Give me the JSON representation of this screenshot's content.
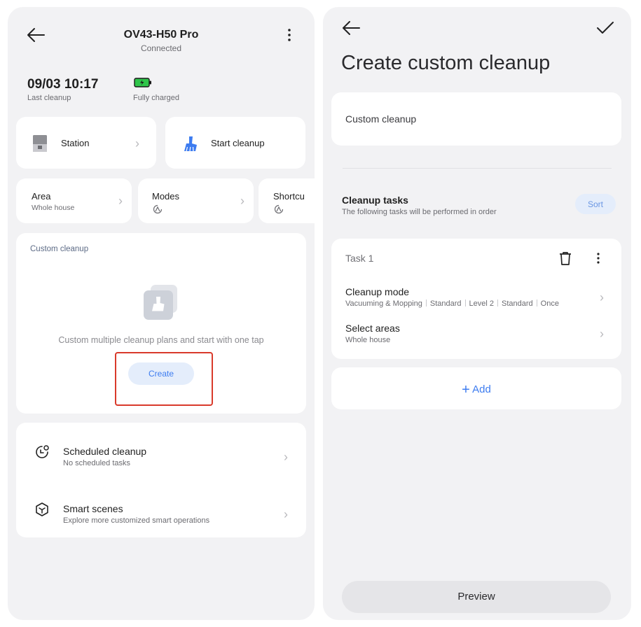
{
  "left": {
    "title": "OV43-H50 Pro",
    "status": "Connected",
    "last_cleanup_time": "09/03 10:17",
    "last_cleanup_label": "Last cleanup",
    "battery_label": "Fully charged",
    "station_label": "Station",
    "start_cleanup_label": "Start cleanup",
    "area_title": "Area",
    "area_value": "Whole house",
    "modes_title": "Modes",
    "shortcuts_title": "Shortcu",
    "custom_cleanup_title": "Custom cleanup",
    "empty_text": "Custom multiple cleanup plans and start with one tap",
    "create_label": "Create",
    "scheduled_title": "Scheduled cleanup",
    "scheduled_sub": "No scheduled tasks",
    "smart_title": "Smart scenes",
    "smart_sub": "Explore more customized smart operations"
  },
  "right": {
    "page_title": "Create custom cleanup",
    "name_value": "Custom cleanup",
    "tasks_title": "Cleanup tasks",
    "tasks_sub": "The following tasks will be performed in order",
    "sort_label": "Sort",
    "task_label": "Task 1",
    "cleanup_mode_title": "Cleanup mode",
    "cleanup_mode_values": [
      "Vacuuming & Mopping",
      "Standard",
      "Level 2",
      "Standard",
      "Once"
    ],
    "select_areas_title": "Select areas",
    "select_areas_value": "Whole house",
    "add_label": "Add",
    "preview_label": "Preview"
  },
  "colors": {
    "accent": "#3d7cf0",
    "highlight_border": "#d93a2b",
    "battery_green": "#2fc54a",
    "create_button_bg": "#e4edfb",
    "panel_bg": "#f2f2f4"
  },
  "icons": [
    "back-arrow-icon",
    "more-vertical-icon",
    "battery-icon",
    "station-icon",
    "start-cleanup-icon",
    "mode-icon",
    "custom-cleanup-icon",
    "schedule-clock-icon",
    "smart-scenes-cube-icon",
    "check-icon",
    "trash-icon",
    "plus-icon",
    "chevron-right-icon"
  ]
}
